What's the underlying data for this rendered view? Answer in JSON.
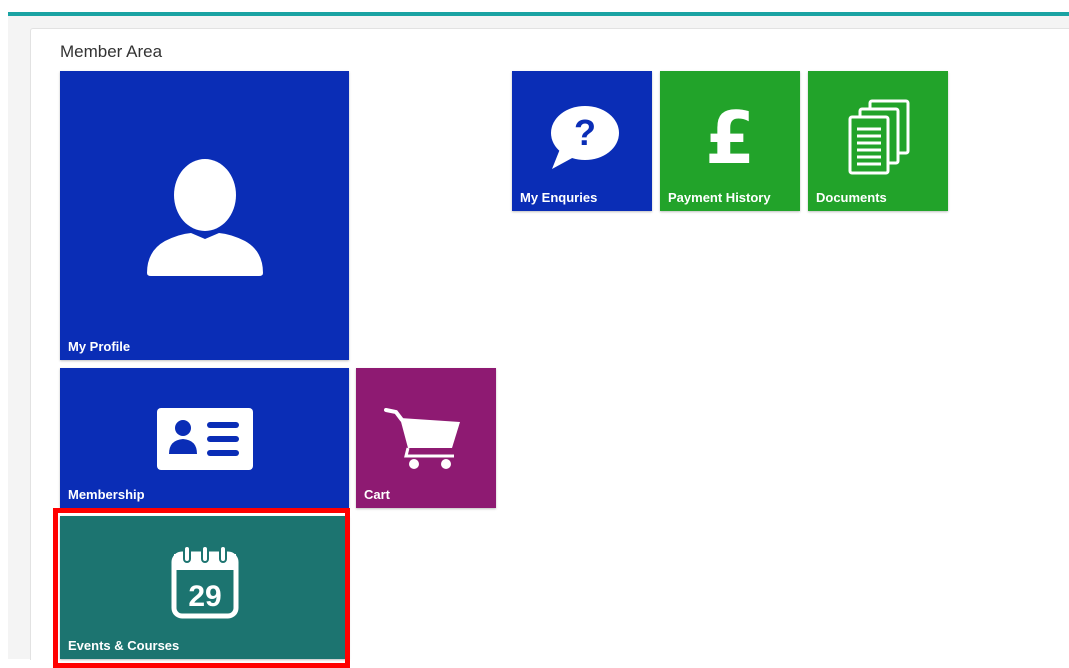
{
  "page": {
    "title": "Member Area",
    "accent_color": "#1aa3a3"
  },
  "tiles": {
    "profile": {
      "label": "My Profile",
      "icon": "user-icon",
      "color": "#0a2db6"
    },
    "enquiries": {
      "label": "My Enquries",
      "icon": "speech-bubble-question-icon",
      "color": "#0a2db6"
    },
    "payment": {
      "label": "Payment History",
      "icon": "pound-sign-icon",
      "color": "#22a32a"
    },
    "documents": {
      "label": "Documents",
      "icon": "documents-icon",
      "color": "#22a32a"
    },
    "membership": {
      "label": "Membership",
      "icon": "id-card-icon",
      "color": "#0a2db6"
    },
    "cart": {
      "label": "Cart",
      "icon": "shopping-cart-icon",
      "color": "#8e1a72"
    },
    "events": {
      "label": "Events & Courses",
      "icon": "calendar-icon",
      "color": "#1c7470",
      "calendar_day": "29"
    }
  },
  "highlight": {
    "target": "events",
    "color": "#ff0000"
  }
}
